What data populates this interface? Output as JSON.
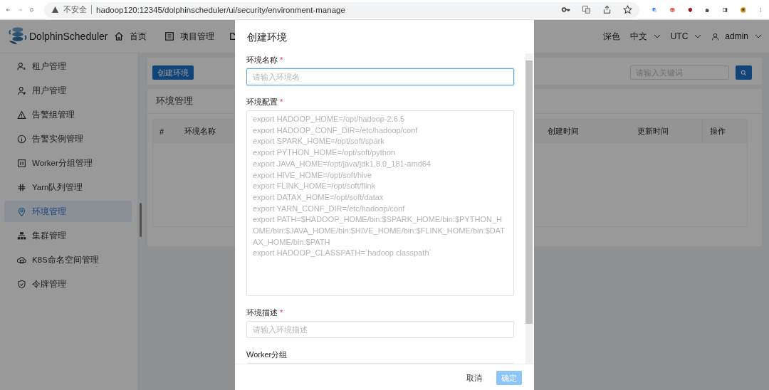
{
  "browser": {
    "security_label": "不安全",
    "url": "hadoop120:12345/dolphinscheduler/ui/security/environment-manage"
  },
  "header": {
    "logo": "DolphinScheduler",
    "nav": [
      "首页",
      "项目管理"
    ],
    "theme": "深色",
    "language": "中文",
    "timezone": "UTC",
    "user": "admin"
  },
  "sidebar": {
    "items": [
      {
        "label": "租户管理",
        "selected": false
      },
      {
        "label": "用户管理",
        "selected": false
      },
      {
        "label": "告警组管理",
        "selected": false
      },
      {
        "label": "告警实例管理",
        "selected": false
      },
      {
        "label": "Worker分组管理",
        "selected": false
      },
      {
        "label": "Yarn队列管理",
        "selected": false
      },
      {
        "label": "环境管理",
        "selected": true
      },
      {
        "label": "集群管理",
        "selected": false
      },
      {
        "label": "K8S命名空间管理",
        "selected": false
      },
      {
        "label": "令牌管理",
        "selected": false
      }
    ]
  },
  "toolbar": {
    "create_button": "创建环境",
    "search": {
      "placeholder": "请输入关键词"
    }
  },
  "table": {
    "title": "环境管理",
    "columns": [
      "#",
      "环境名称",
      "创建时间",
      "更新时间",
      "操作"
    ]
  },
  "dialog": {
    "title": "创建环境",
    "required_mark": "*",
    "fields": [
      {
        "kind": "input",
        "label": "环境名称",
        "required": true,
        "placeholder": "请输入环境名",
        "focused": true
      },
      {
        "kind": "textarea",
        "label": "环境配置",
        "required": true,
        "placeholder": "export HADOOP_HOME=/opt/hadoop-2.6.5\nexport HADOOP_CONF_DIR=/etc/hadoop/conf\nexport SPARK_HOME=/opt/soft/spark\nexport PYTHON_HOME=/opt/soft/python\nexport JAVA_HOME=/opt/java/jdk1.8.0_181-amd64\nexport HIVE_HOME=/opt/soft/hive\nexport FLINK_HOME=/opt/soft/flink\nexport DATAX_HOME=/opt/soft/datax\nexport YARN_CONF_DIR=/etc/hadoop/conf\nexport PATH=$HADOOP_HOME/bin:$SPARK_HOME/bin:$PYTHON_HOME/bin:$JAVA_HOME/bin:$HIVE_HOME/bin:$FLINK_HOME/bin:$DATAX_HOME/bin:$PATH\nexport HADOOP_CLASSPATH=`hadoop classpath`",
        "focused": false
      },
      {
        "kind": "input",
        "label": "环境描述",
        "required": true,
        "placeholder": "请输入环境描述",
        "focused": false
      },
      {
        "kind": "select",
        "label": "Worker分组",
        "required": false,
        "focused": false
      }
    ],
    "cancel": "取消",
    "confirm": {
      "label": "确定",
      "disabled": true
    }
  }
}
